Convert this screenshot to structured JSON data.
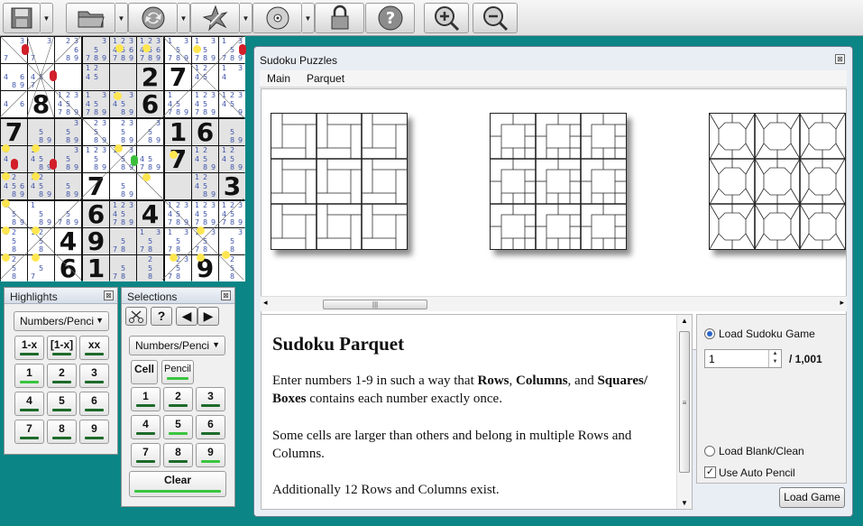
{
  "toolbar": {
    "buttons": [
      {
        "icon": "save-icon"
      },
      {
        "icon": "folder-open-icon"
      },
      {
        "icon": "refresh-icon"
      },
      {
        "icon": "magic-wand-icon"
      },
      {
        "icon": "disc-icon"
      },
      {
        "icon": "lock-icon"
      },
      {
        "icon": "help-icon"
      },
      {
        "icon": "zoom-in-icon"
      },
      {
        "icon": "zoom-out-icon"
      }
    ]
  },
  "board": {
    "givens": [
      [
        "",
        "",
        "",
        "",
        "",
        "",
        "",
        "",
        ""
      ],
      [
        "",
        "",
        "",
        "",
        "",
        "2",
        "7",
        "",
        ""
      ],
      [
        "",
        "8",
        "",
        "",
        "",
        "6",
        "",
        "",
        ""
      ],
      [
        "7",
        "",
        "",
        "",
        "",
        "",
        "1",
        "6",
        ""
      ],
      [
        "",
        "",
        "",
        "",
        "",
        "",
        "7",
        "",
        ""
      ],
      [
        "",
        "",
        "",
        "7",
        "",
        "",
        "",
        "",
        "3"
      ],
      [
        "",
        "",
        "",
        "6",
        "",
        "4",
        "",
        "",
        ""
      ],
      [
        "",
        "",
        "4",
        "9",
        "",
        "",
        "",
        "",
        ""
      ],
      [
        "",
        "",
        "6",
        "1",
        "",
        "",
        "",
        "9",
        ""
      ]
    ],
    "grey": [
      [
        0,
        0,
        0,
        1,
        1,
        1,
        0,
        0,
        0
      ],
      [
        0,
        0,
        0,
        1,
        1,
        1,
        0,
        0,
        0
      ],
      [
        0,
        0,
        0,
        1,
        1,
        1,
        0,
        0,
        0
      ],
      [
        1,
        1,
        1,
        0,
        0,
        0,
        1,
        1,
        1
      ],
      [
        1,
        1,
        1,
        0,
        0,
        0,
        1,
        1,
        1
      ],
      [
        1,
        1,
        1,
        0,
        0,
        0,
        1,
        1,
        1
      ],
      [
        0,
        0,
        0,
        1,
        1,
        1,
        0,
        0,
        0
      ],
      [
        0,
        0,
        0,
        1,
        1,
        1,
        0,
        0,
        0
      ],
      [
        0,
        0,
        0,
        1,
        1,
        1,
        0,
        0,
        0
      ]
    ],
    "pencil": [
      [
        "  3   7 ",
        "  3   7 ",
        " 23  6 89",
        "  3 5 789",
        "123456789",
        "123456789",
        "1 3 5 789",
        "1 3 5 789",
        "1 3 5 789"
      ],
      [
        "4 6 89",
        " 45 7 ",
        "",
        "12 45 ",
        "   ",
        "",
        "",
        "12 45 ",
        "1 3 4 "
      ],
      [
        " 4 6  ",
        "",
        "12345 789",
        "1 345 789",
        "1 345 89",
        "",
        "1  45 789",
        "12345 789",
        "12345 9"
      ],
      [
        "",
        "  5 89",
        " 3 5 89",
        "23 5 89",
        "23 5 89",
        " 3 5 89",
        "",
        "",
        "  5 89"
      ],
      [
        "1 4   ",
        "1 45 89",
        " 3 5 89",
        "123 5 89",
        "1 3 5 89",
        "  45 789",
        "",
        "12 45 89",
        "12 45 89"
      ],
      [
        "12 456 89",
        "12 45 89",
        "  5 89",
        "",
        "  5 89",
        "",
        "",
        "12 45 89",
        ""
      ],
      [
        "1  5  89",
        "1  5  89",
        "  5 789",
        "",
        "12345 789",
        "",
        "12345 789",
        "12345 789",
        "12345 789"
      ],
      [
        "12 5 8",
        "12 5 8",
        "",
        "",
        "  5 78",
        "1 3 5 78",
        "1 3 5 78",
        "1 3 5 78",
        " 3 5 8"
      ],
      [
        " 2 5 8",
        "  5 7",
        "",
        "",
        "  5 78",
        " 2 5 8",
        " 23 5 78",
        "",
        " 2 5 8"
      ]
    ]
  },
  "highlights": {
    "title": "Highlights",
    "close": "⊠",
    "dropdown": "Numbers/Penci",
    "row1": [
      "1-x",
      "[1-x]",
      "xx"
    ],
    "numbers": [
      "1",
      "2",
      "3",
      "4",
      "5",
      "6",
      "7",
      "8",
      "9"
    ]
  },
  "selections": {
    "title": "Selections",
    "close": "⊠",
    "dropdown": "Numbers/Penci",
    "mode": [
      "Cell",
      "Pencil"
    ],
    "numbers": [
      "1",
      "2",
      "3",
      "4",
      "5",
      "6",
      "7",
      "8",
      "9"
    ],
    "clear": "Clear"
  },
  "window": {
    "title": "Sudoku Puzzles",
    "close": "⊠",
    "menu": [
      "Main",
      "Parquet"
    ],
    "heading": "Sudoku Parquet",
    "paragraphs": [
      "Enter numbers 1-9 in such a way that Rows, Columns, and Squares/ Boxes contains each number exactly once.",
      "Some cells are larger than others and belong in multiple Rows and Columns.",
      "Additionally 12 Rows and Columns exist."
    ],
    "bold_words": [
      "Rows",
      "Columns",
      "Squares/",
      "Boxes"
    ],
    "options": {
      "load_game": "Load Sudoku Game",
      "game_number": "1",
      "total": "/ 1,001",
      "load_blank": "Load Blank/Clean",
      "auto_pencil": "Use Auto Pencil",
      "auto_pencil_checked": true,
      "load_button": "Load Game"
    }
  }
}
